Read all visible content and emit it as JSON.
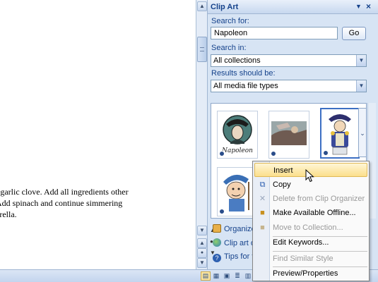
{
  "document": {
    "lines": [
      "l garlic clove.  Add all ingredients other",
      " Add spinach and continue simmering",
      "arella."
    ]
  },
  "task_pane": {
    "title": "Clip Art",
    "search_for_label": "Search for:",
    "search_value": "Napoleon",
    "go_label": "Go",
    "search_in_label": "Search in:",
    "search_in_value": "All collections",
    "results_label": "Results should be:",
    "results_value": "All media file types",
    "thumbnails": [
      {
        "name": "napoleon-logo-clip",
        "caption": "Napoleon"
      },
      {
        "name": "napoleon-painting-clip"
      },
      {
        "name": "napoleon-cartoon-clip",
        "selected": true
      },
      {
        "name": "soldier-cartoon-clip"
      }
    ],
    "links": [
      {
        "label": "Organize",
        "icon": "organize-clips-icon"
      },
      {
        "label": "Clip art on",
        "icon": "clip-art-online-icon"
      },
      {
        "label": "Tips for fi",
        "icon": "tips-help-icon"
      }
    ]
  },
  "context_menu": {
    "items": [
      {
        "label": "Insert",
        "underline": "I",
        "enabled": true,
        "highlighted": true,
        "icon": ""
      },
      {
        "label": "Copy",
        "underline": "C",
        "enabled": true,
        "icon": "copy-icon"
      },
      {
        "label": "Delete from Clip Organizer",
        "underline": "D",
        "enabled": false,
        "icon": "delete-x-icon"
      },
      {
        "label": "Make Available Offline...",
        "underline": "M",
        "enabled": true,
        "icon": "offline-folder-icon"
      },
      {
        "label": "Move to Collection...",
        "underline": "M",
        "enabled": false,
        "icon": "move-folder-icon"
      },
      {
        "label": "Edit Keywords...",
        "underline": "K",
        "enabled": true,
        "icon": ""
      },
      {
        "label": "Find Similar Style",
        "underline": "S",
        "enabled": false,
        "icon": ""
      },
      {
        "label": "Preview/Properties",
        "underline": "P",
        "enabled": true,
        "icon": ""
      }
    ]
  },
  "colors": {
    "pane_bg": "#d7e4f4",
    "pane_title_text": "#15428b",
    "menu_highlight": "#fbdf8c"
  }
}
